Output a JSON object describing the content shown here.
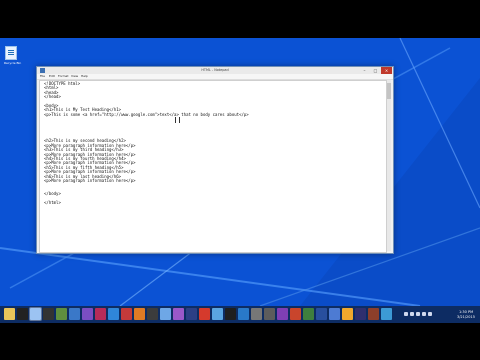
{
  "desktop": {
    "icons": [
      {
        "label": "Recycle Bin",
        "icon": "document-icon"
      }
    ]
  },
  "window": {
    "title": "HTML - Notepad",
    "menu": [
      "File",
      "Edit",
      "Format",
      "View",
      "Help"
    ],
    "controls": {
      "minimize": "–",
      "maximize": "□",
      "close": "×"
    },
    "editor_text": "<!DOCTYPE html>\n<html>\n<head>\n</head>\n\n<body>\n<h1>This is My Test Heading</h1>\n<p>This is some <a href=\"http://www.google.com\">text</a> that no body cares about</p>\n\n\n\n\n\n<h2>This is my second heading</h2>\n<p>More paragraph information here</p>\n<h3>This is my third heading</h3>\n<p>More paragraph information here</p>\n<h4>This is my fourth heading</h4>\n<p>More paragraph information here</p>\n<h5>This is my fifth heading</h5>\n<p>More paragraph information here</p>\n<h6>This is my last heading</h6>\n<p>More paragraph information here</p>\n\n\n</body>\n\n</html>"
  },
  "taskbar": {
    "apps": [
      {
        "name": "file-explorer-icon",
        "color": "#e8c45a"
      },
      {
        "name": "command-prompt-icon",
        "color": "#222222"
      },
      {
        "name": "notepad-icon",
        "color": "#9cc3f2"
      },
      {
        "name": "terminal-icon",
        "color": "#333333"
      },
      {
        "name": "app-icon",
        "color": "#5f8f3f"
      },
      {
        "name": "app-icon",
        "color": "#3a78c8"
      },
      {
        "name": "app-icon",
        "color": "#7a4ec2"
      },
      {
        "name": "app-icon",
        "color": "#b72b59"
      },
      {
        "name": "app-icon",
        "color": "#2f86d9"
      },
      {
        "name": "app-icon",
        "color": "#c33a3a"
      },
      {
        "name": "app-icon",
        "color": "#e07b24"
      },
      {
        "name": "app-icon",
        "color": "#3c3c3c"
      },
      {
        "name": "app-icon",
        "color": "#6ea7e6"
      },
      {
        "name": "app-icon",
        "color": "#9a58c9"
      },
      {
        "name": "app-icon",
        "color": "#2c3f85"
      },
      {
        "name": "app-icon",
        "color": "#d53a2c"
      },
      {
        "name": "app-icon",
        "color": "#5aa5e1"
      },
      {
        "name": "app-icon",
        "color": "#1f1f1f"
      },
      {
        "name": "app-icon",
        "color": "#2979c9"
      },
      {
        "name": "app-icon",
        "color": "#777777"
      },
      {
        "name": "app-icon",
        "color": "#5c5c5c"
      },
      {
        "name": "app-icon",
        "color": "#7f3fb5"
      },
      {
        "name": "app-icon",
        "color": "#c9452c"
      },
      {
        "name": "app-icon",
        "color": "#3e7f3e"
      },
      {
        "name": "app-icon",
        "color": "#284f9e"
      },
      {
        "name": "app-icon",
        "color": "#4d7bd3"
      },
      {
        "name": "app-icon",
        "color": "#f0a82d"
      },
      {
        "name": "app-icon",
        "color": "#2f2f6f"
      },
      {
        "name": "app-icon",
        "color": "#8d3f2a"
      },
      {
        "name": "app-icon",
        "color": "#3c9ad6"
      }
    ],
    "tray": {
      "time": "1:30 PM",
      "date": "3/21/2015"
    }
  },
  "colors": {
    "desktop": "#0a4cc8",
    "taskbar": "#0d2c63",
    "close_button": "#c0392b"
  }
}
